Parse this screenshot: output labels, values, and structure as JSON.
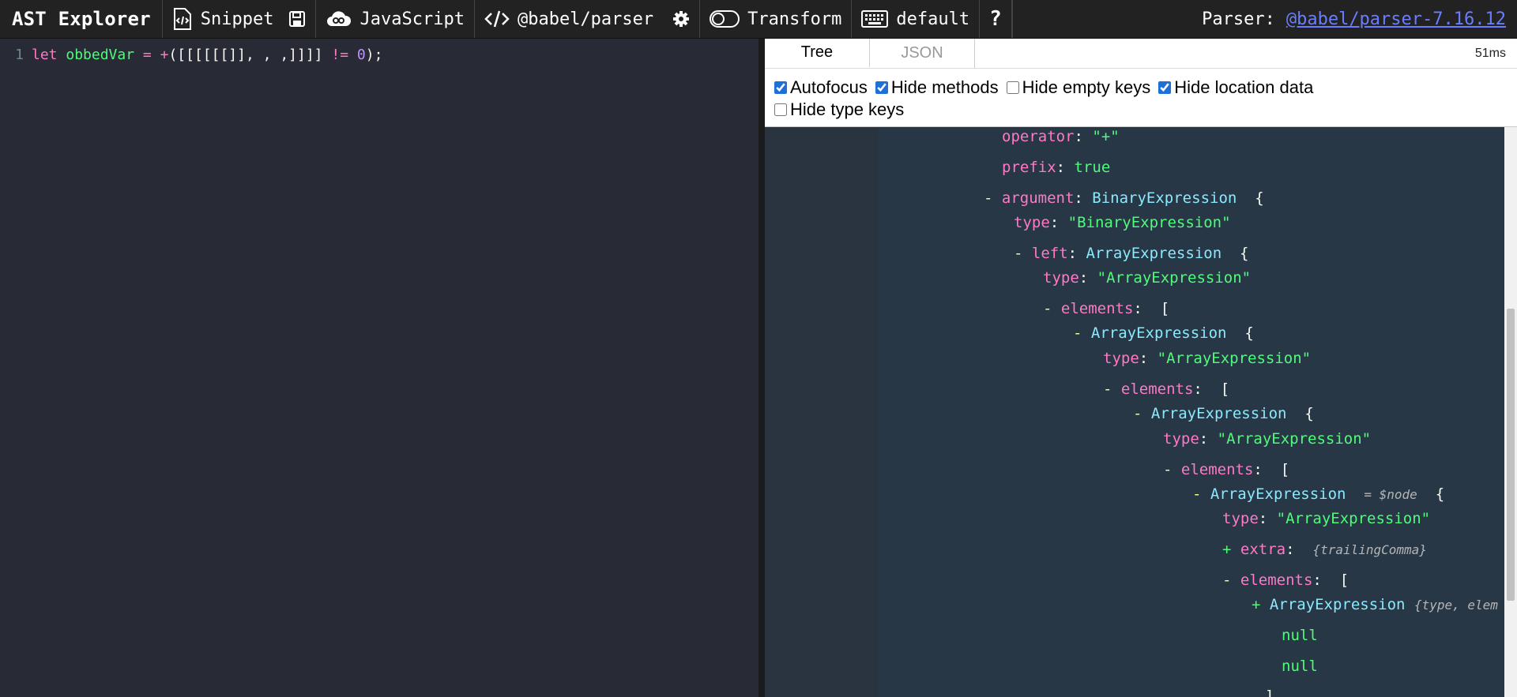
{
  "toolbar": {
    "brand": "AST Explorer",
    "snippet": "Snippet",
    "language": "JavaScript",
    "parser": "@babel/parser",
    "transform": "Transform",
    "keymap": "default",
    "help": "?",
    "parser_label": "Parser:",
    "parser_link": "@babel/parser-7.16.12"
  },
  "editor": {
    "line_number": "1",
    "code": {
      "kw": "let",
      "name": "obbedVar",
      "eq": "=",
      "plus": "+",
      "open": "(",
      "array": "[[[[[[]], , ,]]]]",
      "ne": "!=",
      "num": "0",
      "end": ");"
    }
  },
  "output": {
    "tabs": [
      "Tree",
      "JSON"
    ],
    "active_tab": "Tree",
    "time": "51ms",
    "options": [
      {
        "label": "Autofocus",
        "checked": true
      },
      {
        "label": "Hide methods",
        "checked": true
      },
      {
        "label": "Hide empty keys",
        "checked": false
      },
      {
        "label": "Hide location data",
        "checked": true
      },
      {
        "label": "Hide type keys",
        "checked": false
      }
    ]
  },
  "tree": [
    {
      "toggle": "",
      "key": "operator",
      "value": "\"+\"",
      "vtype": "s"
    },
    {
      "toggle": "",
      "key": "prefix",
      "value": "true",
      "vtype": "s"
    },
    {
      "toggle": "-",
      "key": "argument",
      "value": "BinaryExpression",
      "vtype": "t",
      "brace": "{"
    },
    {
      "toggle": "",
      "key": "type",
      "value": "\"BinaryExpression\"",
      "vtype": "s"
    },
    {
      "toggle": "-",
      "key": "left",
      "value": "ArrayExpression",
      "vtype": "t",
      "brace": "{"
    },
    {
      "toggle": "",
      "key": "type",
      "value": "\"ArrayExpression\"",
      "vtype": "s"
    },
    {
      "toggle": "-",
      "key": "elements",
      "value": "",
      "vtype": "s",
      "brace": "["
    },
    {
      "toggle": "-",
      "key": "",
      "value": "ArrayExpression",
      "vtype": "t",
      "brace": "{"
    },
    {
      "toggle": "",
      "key": "type",
      "value": "\"ArrayExpression\"",
      "vtype": "s"
    },
    {
      "toggle": "-",
      "key": "elements",
      "value": "",
      "vtype": "s",
      "brace": "["
    },
    {
      "toggle": "-",
      "key": "",
      "value": "ArrayExpression",
      "vtype": "t",
      "brace": "{"
    },
    {
      "toggle": "",
      "key": "type",
      "value": "\"ArrayExpression\"",
      "vtype": "s"
    },
    {
      "toggle": "-",
      "key": "elements",
      "value": "",
      "vtype": "s",
      "brace": "["
    },
    {
      "toggle": "-",
      "key": "",
      "value": "ArrayExpression",
      "vtype": "t",
      "comment": "= $node",
      "brace": "{"
    },
    {
      "toggle": "",
      "key": "type",
      "value": "\"ArrayExpression\"",
      "vtype": "s"
    },
    {
      "toggle": "+",
      "key": "extra",
      "value": "",
      "vtype": "s",
      "summary": "{trailingComma}"
    },
    {
      "toggle": "-",
      "key": "elements",
      "value": "",
      "vtype": "s",
      "brace": "["
    },
    {
      "toggle": "+",
      "key": "",
      "value": "ArrayExpression",
      "vtype": "t",
      "summary": "{type, elem"
    },
    {
      "toggle": "",
      "key": "",
      "value": "null",
      "vtype": "s"
    },
    {
      "toggle": "",
      "key": "",
      "value": "null",
      "vtype": "s"
    },
    {
      "toggle": "",
      "key": "",
      "value": "]",
      "vtype": "p"
    }
  ]
}
